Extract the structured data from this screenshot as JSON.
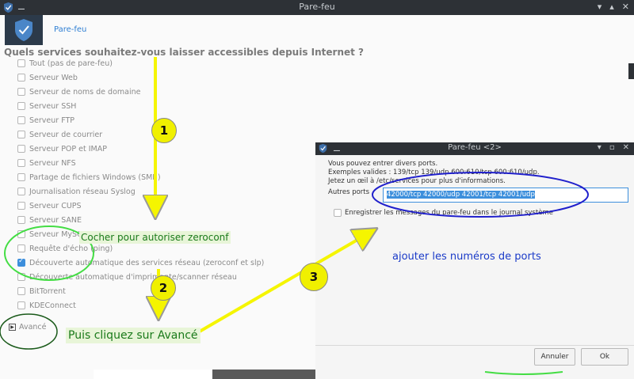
{
  "main_window": {
    "title": "Pare-feu",
    "header_link": "Pare-feu",
    "question": "Quels services souhaitez-vous laisser accessibles depuis Internet ?",
    "services": [
      {
        "label": "Tout (pas de pare-feu)",
        "checked": false
      },
      {
        "label": "Serveur Web",
        "checked": false
      },
      {
        "label": "Serveur de noms de domaine",
        "checked": false
      },
      {
        "label": "Serveur SSH",
        "checked": false
      },
      {
        "label": "Serveur FTP",
        "checked": false
      },
      {
        "label": "Serveur de courrier",
        "checked": false
      },
      {
        "label": "Serveur POP et IMAP",
        "checked": false
      },
      {
        "label": "Serveur NFS",
        "checked": false
      },
      {
        "label": "Partage de fichiers Windows (SMB)",
        "checked": false
      },
      {
        "label": "Journalisation réseau Syslog",
        "checked": false
      },
      {
        "label": "Serveur CUPS",
        "checked": false
      },
      {
        "label": "Serveur SANE",
        "checked": false
      },
      {
        "label": "Serveur MySQL",
        "checked": false
      },
      {
        "label": "Requête d'écho (ping)",
        "checked": false
      },
      {
        "label": "Découverte automatique des services réseau (zeroconf et slp)",
        "checked": true
      },
      {
        "label": "Découverte automatique d'imprimante/scanner réseau",
        "checked": false
      },
      {
        "label": "BitTorrent",
        "checked": false
      },
      {
        "label": "KDEConnect",
        "checked": false
      }
    ],
    "advanced_label": "Avancé"
  },
  "dialog": {
    "title": "Pare-feu <2>",
    "line1": "Vous pouvez entrer divers ports.",
    "line2": "Exemples valides : 139/tcp 139/udp 600:610/tcp 600:610/udp.",
    "line3": "Jetez un œil à /etc/services pour plus d'informations.",
    "ports_label": "Autres ports",
    "ports_value": "42000/tcp 42000/udp 42001/tcp 42001/udp",
    "log_label": "Enregistrer les messages du pare-feu dans le journal système",
    "log_checked": false,
    "cancel_label": "Annuler",
    "ok_label": "Ok"
  },
  "annotations": {
    "step1": "1",
    "step2": "2",
    "step3": "3",
    "note_zeroconf": "Cocher pour autoriser zeroconf",
    "note_avance": "Puis cliquez sur Avancé",
    "note_ports": "ajouter les numéros de ports"
  },
  "colors": {
    "accent": "#3d8fdc",
    "titlebar": "#2d3136",
    "arrow_yellow": "#f5f500",
    "ring_green": "#44dd44",
    "ring_dark_green": "#1a5a1a",
    "ring_blue": "#2020cc"
  }
}
